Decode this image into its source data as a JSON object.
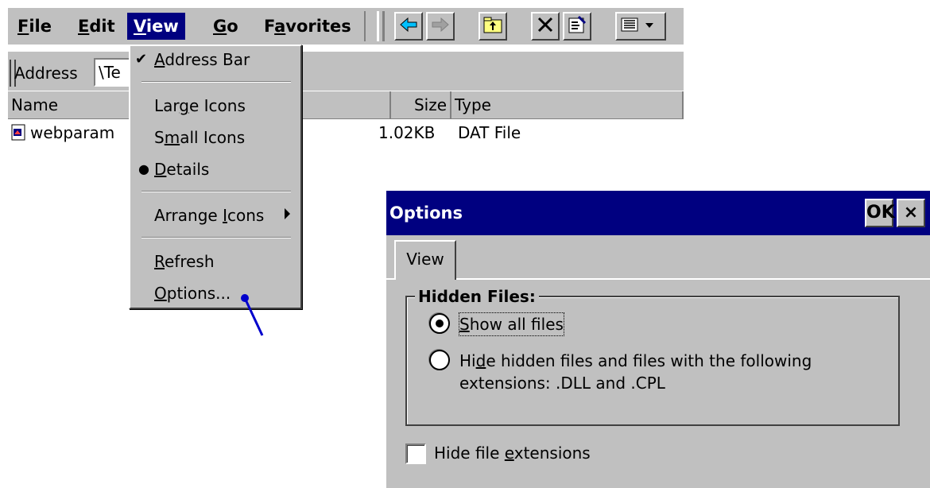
{
  "menubar": {
    "items": [
      {
        "pre": "",
        "key": "F",
        "post": "ile"
      },
      {
        "pre": "",
        "key": "E",
        "post": "dit"
      },
      {
        "pre": "",
        "key": "V",
        "post": "iew"
      },
      {
        "pre": "",
        "key": "G",
        "post": "o"
      },
      {
        "pre": "F",
        "key": "a",
        "post": "vorites"
      }
    ]
  },
  "toolbar": {
    "back_icon": "back-arrow-icon",
    "forward_icon": "forward-arrow-icon",
    "up_icon": "up-folder-icon",
    "delete_icon": "delete-x-icon",
    "properties_icon": "properties-icon",
    "views_icon": "views-icon"
  },
  "address": {
    "label": "Address",
    "value": "\\Te"
  },
  "columns": {
    "name": "Name",
    "size": "Size",
    "type": "Type"
  },
  "files": [
    {
      "name": "webparam",
      "size": "1.02KB",
      "type": "DAT File"
    }
  ],
  "view_menu": {
    "address_bar": {
      "pre": "",
      "key": "A",
      "post": "ddress Bar"
    },
    "large_icons": {
      "pre": "Lar",
      "key": "g",
      "post": "e Icons"
    },
    "small_icons": {
      "pre": "S",
      "key": "m",
      "post": "all Icons"
    },
    "details": {
      "pre": "",
      "key": "D",
      "post": "etails"
    },
    "arrange_icons": {
      "pre": "Arrange ",
      "key": "I",
      "post": "cons"
    },
    "refresh": {
      "pre": "",
      "key": "R",
      "post": "efresh"
    },
    "options": {
      "pre": "",
      "key": "O",
      "post": "ptions..."
    }
  },
  "dialog": {
    "title": "Options",
    "ok_label": "OK",
    "close_label": "×",
    "tab_view": "View",
    "group_title": "Hidden Files:",
    "show_all": {
      "pre": "",
      "key": "S",
      "post": "how all files",
      "checked": true
    },
    "hide_hidden": {
      "pre": "Hi",
      "key": "d",
      "post": "e hidden files and files with the following",
      "line2": "extensions: .DLL and .CPL",
      "checked": false
    },
    "hide_ext": {
      "pre": "Hide file ",
      "key": "e",
      "post": "xtensions",
      "checked": false
    }
  },
  "colors": {
    "titlebar": "#000080",
    "face": "#c0c0c0",
    "pointer": "#0000cc"
  }
}
